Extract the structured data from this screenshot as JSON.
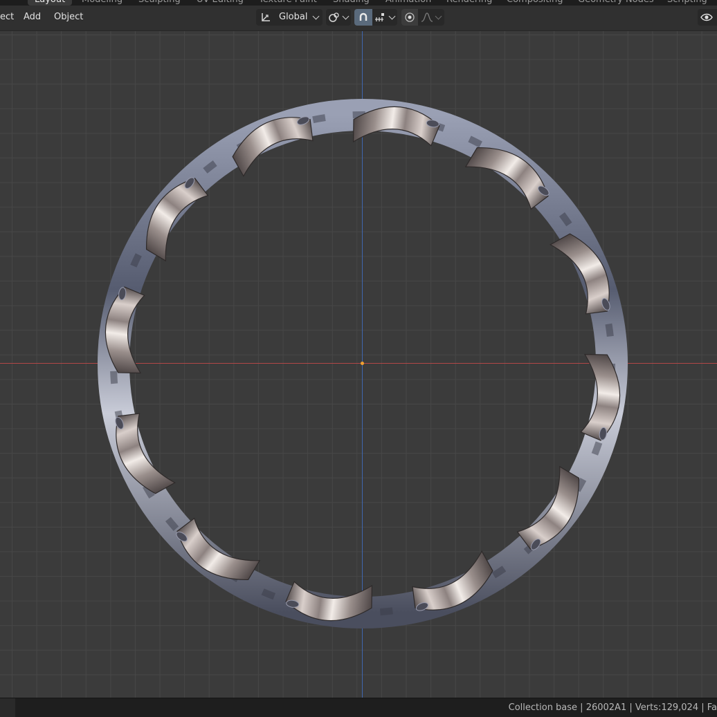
{
  "workspace_tabs": [
    {
      "label": "Layout",
      "active": true
    },
    {
      "label": "Modeling",
      "active": false
    },
    {
      "label": "Sculpting",
      "active": false
    },
    {
      "label": "UV Editing",
      "active": false
    },
    {
      "label": "Texture Paint",
      "active": false
    },
    {
      "label": "Shading",
      "active": false
    },
    {
      "label": "Animation",
      "active": false
    },
    {
      "label": "Rendering",
      "active": false
    },
    {
      "label": "Compositing",
      "active": false
    },
    {
      "label": "Geometry Nodes",
      "active": false
    },
    {
      "label": "Scripting",
      "active": false
    }
  ],
  "header_menu": {
    "object_mode_partial": "ect",
    "add": "Add",
    "object": "Object"
  },
  "transform": {
    "orientation_label": "Global",
    "icon": "transform-orientation-icon"
  },
  "tools": {
    "pivot_icon": "pivot-point-icon",
    "snap_icon": "snap-magnet-icon",
    "snap_target_icon": "snap-increment-icon",
    "proportional_icon": "proportional-editing-icon",
    "falloff_icon": "falloff-curve-icon"
  },
  "overlay": {
    "icon": "visibility-eye-icon"
  },
  "colors": {
    "x_axis": "#b34848",
    "y_axis": "#3f67b0",
    "origin": "#f0a030",
    "metal_light": "#f2ece8",
    "metal_dark": "#5e5656"
  },
  "status": {
    "text": "Collection base | 26002A1 | Verts:129,024 | Fa"
  }
}
